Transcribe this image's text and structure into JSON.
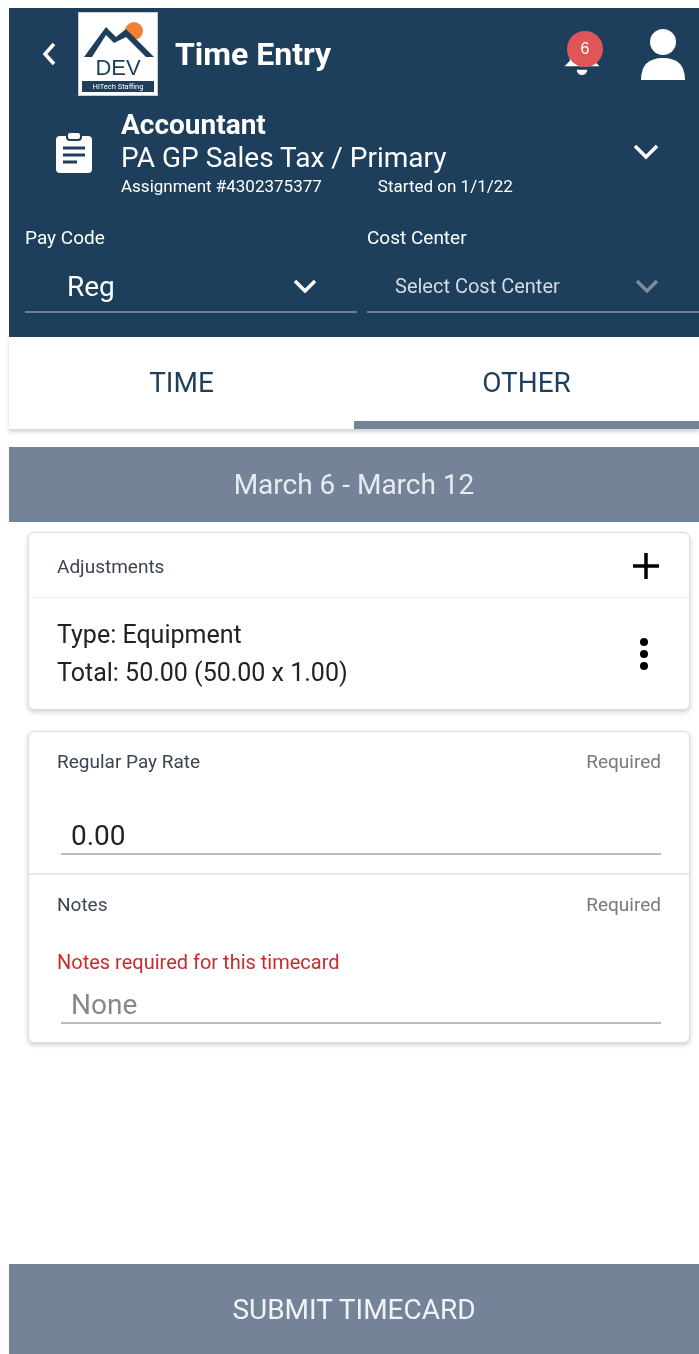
{
  "header": {
    "title": "Time Entry",
    "logo": {
      "text": "DEV",
      "subtext": "HiTech Staffing"
    },
    "notification_count": "6"
  },
  "assignment": {
    "title": "Accountant",
    "subtitle": "PA GP Sales Tax / Primary",
    "number": "Assignment #4302375377",
    "started": "Started on 1/1/22"
  },
  "selectors": [
    {
      "label": "Pay Code",
      "value": "Reg",
      "placeholder": false
    },
    {
      "label": "Cost Center",
      "value": "Select Cost Center",
      "placeholder": true
    }
  ],
  "tabs": [
    {
      "label": "TIME",
      "selected": false
    },
    {
      "label": "OTHER",
      "selected": true
    }
  ],
  "week": "March 6 - March 12",
  "adjustments": {
    "title": "Adjustments",
    "items": [
      {
        "type": "Type: Equipment",
        "total": "Total: 50.00 (50.00 x 1.00)"
      }
    ]
  },
  "fields": [
    {
      "label": "Regular Pay Rate",
      "required": "Required",
      "value": "0.00"
    },
    {
      "label": "Notes",
      "required": "Required",
      "error": "Notes required for this timecard",
      "placeholder": "None"
    }
  ],
  "submit": "SUBMIT TIMECARD"
}
